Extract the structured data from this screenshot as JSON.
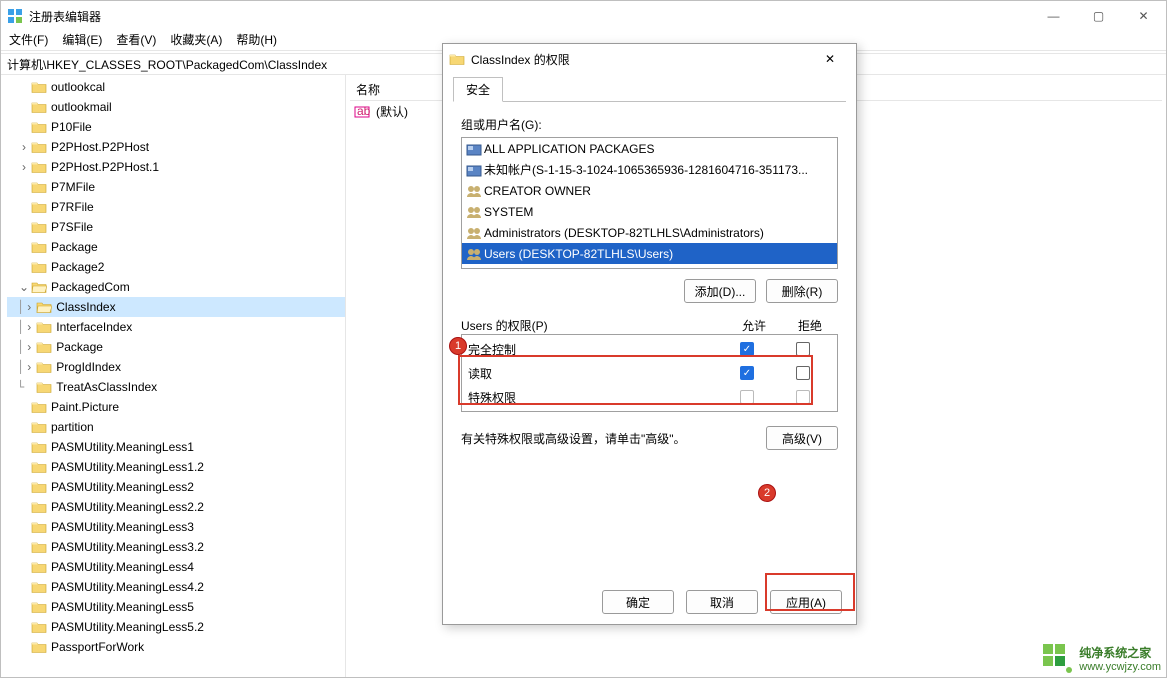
{
  "window": {
    "title": "注册表编辑器",
    "controls": {
      "min": "—",
      "max": "▢",
      "close": "✕"
    }
  },
  "menu": {
    "file": "文件(F)",
    "edit": "编辑(E)",
    "view": "查看(V)",
    "fav": "收藏夹(A)",
    "help": "帮助(H)"
  },
  "address": "计算机\\HKEY_CLASSES_ROOT\\PackagedCom\\ClassIndex",
  "tree": [
    {
      "d": 1,
      "exp": "",
      "name": "outlookcal"
    },
    {
      "d": 1,
      "exp": "",
      "name": "outlookmail"
    },
    {
      "d": 1,
      "exp": "",
      "name": "P10File"
    },
    {
      "d": 1,
      "exp": ">",
      "name": "P2PHost.P2PHost"
    },
    {
      "d": 1,
      "exp": ">",
      "name": "P2PHost.P2PHost.1"
    },
    {
      "d": 1,
      "exp": "",
      "name": "P7MFile"
    },
    {
      "d": 1,
      "exp": "",
      "name": "P7RFile"
    },
    {
      "d": 1,
      "exp": "",
      "name": "P7SFile"
    },
    {
      "d": 1,
      "exp": "",
      "name": "Package"
    },
    {
      "d": 1,
      "exp": "",
      "name": "Package2"
    },
    {
      "d": 1,
      "exp": "v",
      "name": "PackagedCom"
    },
    {
      "d": 2,
      "exp": ">",
      "name": "ClassIndex",
      "sel": true
    },
    {
      "d": 2,
      "exp": ">",
      "name": "InterfaceIndex"
    },
    {
      "d": 2,
      "exp": ">",
      "name": "Package"
    },
    {
      "d": 2,
      "exp": ">",
      "name": "ProgIdIndex"
    },
    {
      "d": 2,
      "exp": "",
      "name": "TreatAsClassIndex",
      "last": true
    },
    {
      "d": 1,
      "exp": "",
      "name": "Paint.Picture"
    },
    {
      "d": 1,
      "exp": "",
      "name": "partition"
    },
    {
      "d": 1,
      "exp": "",
      "name": "PASMUtility.MeaningLess1"
    },
    {
      "d": 1,
      "exp": "",
      "name": "PASMUtility.MeaningLess1.2"
    },
    {
      "d": 1,
      "exp": "",
      "name": "PASMUtility.MeaningLess2"
    },
    {
      "d": 1,
      "exp": "",
      "name": "PASMUtility.MeaningLess2.2"
    },
    {
      "d": 1,
      "exp": "",
      "name": "PASMUtility.MeaningLess3"
    },
    {
      "d": 1,
      "exp": "",
      "name": "PASMUtility.MeaningLess3.2"
    },
    {
      "d": 1,
      "exp": "",
      "name": "PASMUtility.MeaningLess4"
    },
    {
      "d": 1,
      "exp": "",
      "name": "PASMUtility.MeaningLess4.2"
    },
    {
      "d": 1,
      "exp": "",
      "name": "PASMUtility.MeaningLess5"
    },
    {
      "d": 1,
      "exp": "",
      "name": "PASMUtility.MeaningLess5.2"
    },
    {
      "d": 1,
      "exp": "",
      "name": "PassportForWork"
    }
  ],
  "right": {
    "h_name": "名称",
    "value_name": "(默认)"
  },
  "dialog": {
    "title": "ClassIndex 的权限",
    "close": "✕",
    "tab": "安全",
    "group_label": "组或用户名(G):",
    "groups": [
      {
        "icon": "pkg",
        "text": "ALL APPLICATION PACKAGES"
      },
      {
        "icon": "pkg",
        "text": "未知帐户(S-1-15-3-1024-1065365936-1281604716-351173..."
      },
      {
        "icon": "grp",
        "text": "CREATOR OWNER"
      },
      {
        "icon": "grp",
        "text": "SYSTEM"
      },
      {
        "icon": "grp",
        "text": "Administrators (DESKTOP-82TLHLS\\Administrators)"
      },
      {
        "icon": "grp",
        "text": "Users (DESKTOP-82TLHLS\\Users)",
        "sel": true
      }
    ],
    "add": "添加(D)...",
    "remove": "删除(R)",
    "perm_label": "Users 的权限(P)",
    "col_allow": "允许",
    "col_deny": "拒绝",
    "perms": [
      {
        "name": "完全控制",
        "allow": true,
        "deny": false
      },
      {
        "name": "读取",
        "allow": true,
        "deny": false
      },
      {
        "name": "特殊权限",
        "allow": false,
        "deny": false,
        "disabled": true
      }
    ],
    "hint": "有关特殊权限或高级设置，请单击\"高级\"。",
    "advanced": "高级(V)",
    "ok": "确定",
    "cancel": "取消",
    "apply": "应用(A)"
  },
  "callouts": {
    "c1": "1",
    "c2": "2"
  },
  "watermark": {
    "text": "纯净系统之家",
    "url": "www.ycwjzy.com"
  }
}
